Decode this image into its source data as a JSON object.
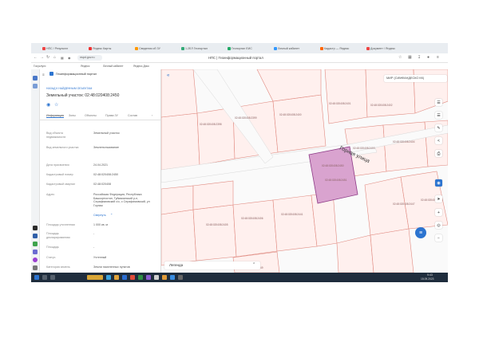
{
  "browser": {
    "tabs": [
      {
        "label": "НПС / Результат",
        "color": "#e44"
      },
      {
        "label": "Яндекс Карты",
        "color": "#e33"
      },
      {
        "label": "Сведения об ЗУ",
        "color": "#f90"
      },
      {
        "label": "1.2ЕЛ Геопортал",
        "color": "#3a7"
      },
      {
        "label": "Геопортал ЕИС",
        "color": "#2a6"
      },
      {
        "label": "Личный кабинет",
        "color": "#39f"
      },
      {
        "label": "Кадастр — Яндекс",
        "color": "#f60"
      },
      {
        "label": "Документ / Яндекс",
        "color": "#e44"
      }
    ],
    "url": "nspd.gov.ru",
    "page_title": "НПС | Геоинформационный портал",
    "bookmarks": [
      "Госуслуги",
      "Яндекс",
      "Личный кабинет",
      "Яндекс Диск"
    ]
  },
  "panel": {
    "header": "Геоинформационный портал",
    "back_link": "НАЗАД К НАЙДЕННЫМ ОБЪЕКТАМ",
    "title": "Земельный участок: 02:48:020408:2450",
    "tabs": [
      "Информация",
      "Зоны",
      "Объекты",
      "Права ЗУ",
      "Состав"
    ],
    "fields": [
      {
        "label": "Вид объекта недвижимости",
        "value": "Земельный участок"
      },
      {
        "label": "Вид земельного участка",
        "value": "Землепользование"
      },
      {
        "label": "Дата присвоения",
        "value": "24.04.2021"
      },
      {
        "label": "Кадастровый номер",
        "value": "02:48:020408:2450"
      },
      {
        "label": "Кадастровый квартал",
        "value": "02:48:020408"
      },
      {
        "label": "Адрес",
        "value": "Российская Федерация, Республика Башкортостан, Туймазинский р-н, Серафимовский с/с, с Серафимовский, ул Горная"
      }
    ],
    "collapse_link": "Свернуть",
    "fields2": [
      {
        "label": "Площадь уточненная",
        "value": "1 000 кв. м"
      },
      {
        "label": "Площадь декларированная",
        "value": "-"
      },
      {
        "label": "Площадь",
        "value": "-"
      },
      {
        "label": "Статус",
        "value": "Учтенный"
      },
      {
        "label": "Категория земель",
        "value": "Земли населенных пунктов"
      }
    ]
  },
  "map": {
    "search_placeholder": "МИР (СИМФАНДЕСКО КК)",
    "street_label": "Горная улица",
    "legend_label": "Легенда",
    "parcels": [
      "02:48:020408:2398",
      "02:48:020408:2399",
      "02:48:020408:2400",
      "02:48:020408:2401",
      "02:48:020408:2402",
      "02:48:020408:2403",
      "02:48:020408:2404",
      "02:48:020408:2405",
      "02:48:020408:2406",
      "02:48:020408:2441",
      "02:48:020408:2447",
      "02:48:020408:2448",
      "02:48:020408:2449",
      "02:48:020408:2451"
    ],
    "selected_parcel": "02:48:020408:2450"
  },
  "taskbar": {
    "time": "9:43",
    "date": "15.09.2023"
  },
  "colors": {
    "selected_fill": "#d9a3cf",
    "selected_stroke": "#8e3b87",
    "parcel_stroke": "#e08a80",
    "accent": "#2c74d0"
  }
}
